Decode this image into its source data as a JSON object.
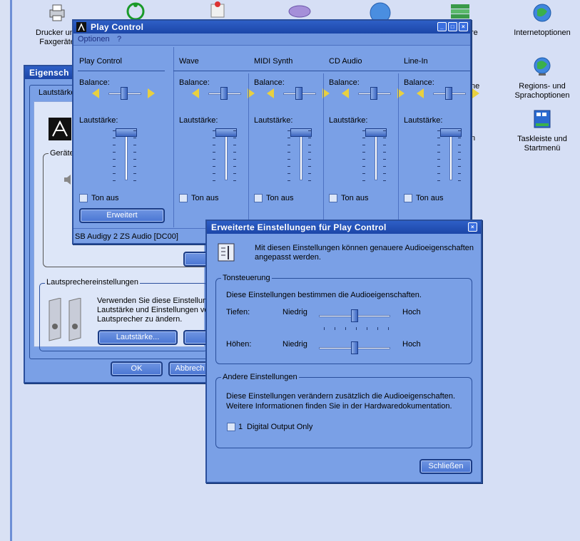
{
  "desktop": {
    "icons": [
      {
        "label": "Drucker und\nFaxgeräte",
        "icon": "printer-icon"
      },
      {
        "label": "Internetoptionen",
        "icon": "globe-icon"
      },
      {
        "label": "Regions- und\nSprachoptionen",
        "icon": "globe-regions-icon"
      },
      {
        "label": "Taskleiste und\nStartmenü",
        "icon": "taskbar-icon"
      }
    ],
    "partial_labels": {
      "re": "re",
      "ne": "ne",
      "n": "n"
    }
  },
  "props_window": {
    "title": "Eigensch",
    "tab": "Lautstärke",
    "device_group": "Geräte",
    "speaker_group": "Lautsprechereinstellungen",
    "speaker_text": "Verwenden Sie diese Einstellung\nLautstärke und Einstellungen ve\nLautsprecher zu ändern.",
    "volume_button": "Lautstärke...",
    "ok": "OK",
    "cancel": "Abbrech"
  },
  "play_control": {
    "title": "Play Control",
    "menu": [
      "Optionen",
      "?"
    ],
    "balance_label": "Balance:",
    "volume_label": "Lautstärke:",
    "mute_label": "Ton aus",
    "advanced_button": "Erweitert",
    "status": "SB Audigy 2 ZS Audio [DC00]",
    "channels": [
      {
        "name": "Play Control"
      },
      {
        "name": "Wave"
      },
      {
        "name": "MIDI Synth"
      },
      {
        "name": "CD Audio"
      },
      {
        "name": "Line-In"
      }
    ]
  },
  "advanced": {
    "title": "Erweiterte Einstellungen für Play Control",
    "intro": "Mit diesen Einstellungen können genauere Audioeigenschaften\nangepasst werden.",
    "tone_group": "Tonsteuerung",
    "tone_text": "Diese Einstellungen bestimmen die Audioeigenschaften.",
    "bass_label": "Tiefen:",
    "treble_label": "Höhen:",
    "low": "Niedrig",
    "high": "Hoch",
    "bass_level": 0.5,
    "treble_level": 0.5,
    "other_group": "Andere Einstellungen",
    "other_text": "Diese Einstellungen verändern zusätzlich die Audioeigenschaften.\nWeitere Informationen finden Sie in der Hardwaredokumentation.",
    "checkbox_num": "1",
    "checkbox_label": "Digital Output Only",
    "close_button": "Schließen"
  }
}
